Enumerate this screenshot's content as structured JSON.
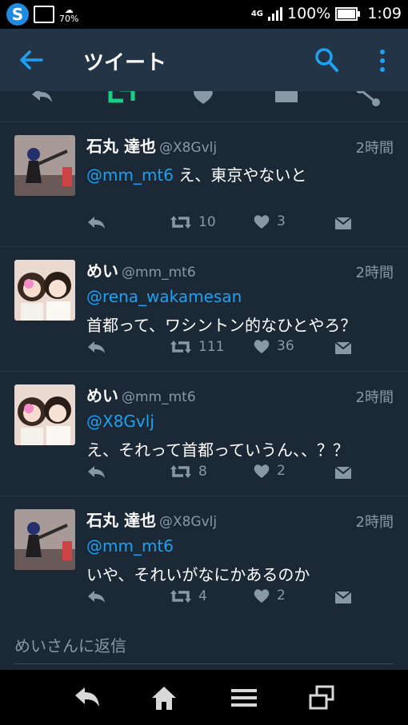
{
  "status_bar": {
    "weather_percent": "70%",
    "network": "4G",
    "battery": "100%",
    "time": "1:09"
  },
  "app_bar": {
    "title": "ツイート"
  },
  "tweets": [
    {
      "name": "石丸 達也",
      "handle": "@X8Gvlj",
      "time": "2時間",
      "reply_to": "@mm_mt6",
      "text_inline": " え、東京やないと",
      "lines": [],
      "retweets": "10",
      "likes": "3"
    },
    {
      "name": "めい",
      "handle": "@mm_mt6",
      "time": "2時間",
      "reply_to": "@rena_wakamesan",
      "text_inline": "",
      "lines": [
        "首都って、ワシントン的なひとやろ？"
      ],
      "retweets": "111",
      "likes": "36"
    },
    {
      "name": "めい",
      "handle": "@mm_mt6",
      "time": "2時間",
      "reply_to": "@X8Gvlj",
      "text_inline": "",
      "lines": [
        "え、それって首都っていうん、、？？"
      ],
      "retweets": "8",
      "likes": "2"
    },
    {
      "name": "石丸 達也",
      "handle": "@X8Gvlj",
      "time": "2時間",
      "reply_to": "@mm_mt6",
      "text_inline": "",
      "lines": [
        "いや、それいがなにかあるのか"
      ],
      "retweets": "4",
      "likes": "2"
    }
  ],
  "reply_box": {
    "placeholder": "めいさんに返信"
  },
  "colors": {
    "accent": "#1da1f2",
    "retweet_green": "#19cf86",
    "background": "#141d26"
  }
}
